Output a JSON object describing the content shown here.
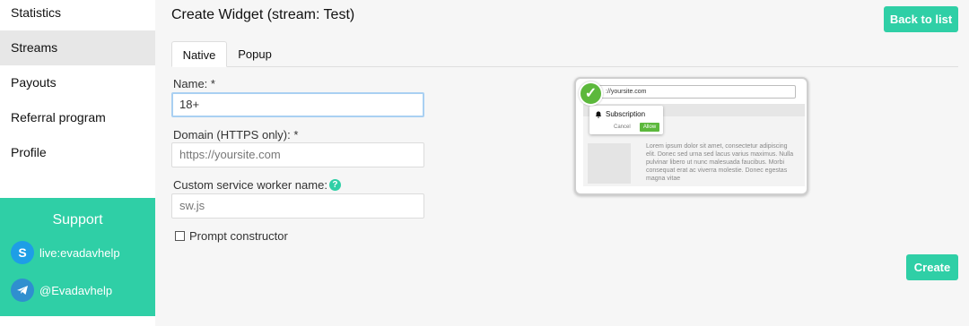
{
  "sidebar": {
    "items": [
      {
        "label": "Statistics"
      },
      {
        "label": "Streams"
      },
      {
        "label": "Payouts"
      },
      {
        "label": "Referral program"
      },
      {
        "label": "Profile"
      }
    ],
    "active_item": "Streams",
    "support": {
      "title": "Support",
      "contacts": [
        {
          "icon": "skype-icon",
          "label": "live:evadavhelp"
        },
        {
          "icon": "telegram-icon",
          "label": "@Evadavhelp"
        }
      ]
    }
  },
  "header": {
    "title": "Create Widget (stream: Test)",
    "back_label": "Back to list"
  },
  "tabs": [
    {
      "label": "Native",
      "active": true
    },
    {
      "label": "Popup",
      "active": false
    }
  ],
  "form": {
    "name_label": "Name: *",
    "name_value": "18+",
    "domain_label": "Domain (HTTPS only): *",
    "domain_placeholder": "https://yoursite.com",
    "worker_label": "Custom service worker name:",
    "worker_help": "?",
    "worker_placeholder": "sw.js",
    "prompt_label": "Prompt constructor",
    "prompt_checked": false,
    "create_label": "Create"
  },
  "preview": {
    "url": "://yoursite.com",
    "popup_title": "Subscription",
    "cancel_label": "Cancel",
    "allow_label": "Allow",
    "body_text": "Lorem ipsum dolor sit amet, consectetur adipiscing elit. Donec sed urna sed lacus varius maximus. Nulla pulvinar libero ut nunc malesuada faucibus. Morbi consequat erat ac viverra molestie. Donec egestas magna vitae"
  },
  "colors": {
    "accent": "#2fcfa6",
    "allow_green": "#5cb83c",
    "focus_border": "#a9d0f2",
    "sidebar_active": "#e7e7e7"
  }
}
